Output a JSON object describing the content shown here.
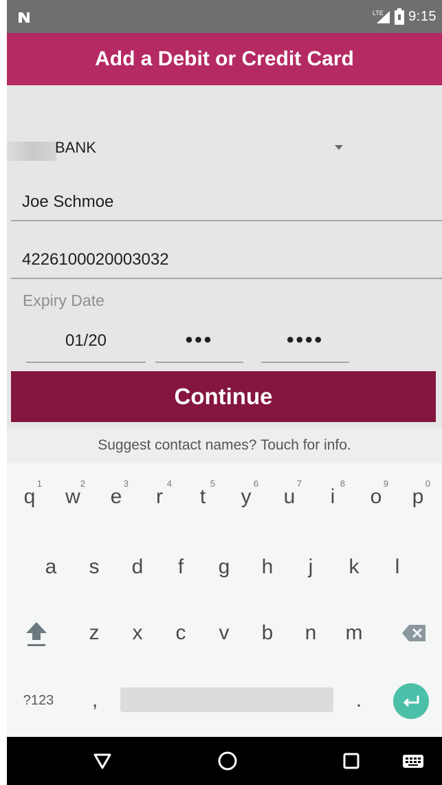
{
  "status_bar": {
    "time": "9:15",
    "network": "LTE"
  },
  "app_bar": {
    "title": "Add a Debit or Credit Card"
  },
  "form": {
    "bank": "BANK",
    "name": "Joe Schmoe",
    "card_number": "4226100020003032",
    "expiry_label": "Expiry Date",
    "expiry_value": "01/20",
    "cvv_masked": "•••",
    "pin_masked": "••••",
    "continue_label": "Continue"
  },
  "suggestion": {
    "text": "Suggest contact names? Touch for info."
  },
  "keyboard": {
    "row1": [
      "q",
      "w",
      "e",
      "r",
      "t",
      "y",
      "u",
      "i",
      "o",
      "p"
    ],
    "row1_hints": [
      "1",
      "2",
      "3",
      "4",
      "5",
      "6",
      "7",
      "8",
      "9",
      "0"
    ],
    "row2": [
      "a",
      "s",
      "d",
      "f",
      "g",
      "h",
      "j",
      "k",
      "l"
    ],
    "row3": [
      "z",
      "x",
      "c",
      "v",
      "b",
      "n",
      "m"
    ],
    "symbols_label": "?123",
    "comma": ",",
    "period": "."
  },
  "icons": {
    "status_left": "notification-n-icon",
    "signal": "signal-icon",
    "battery": "battery-icon",
    "dropdown": "dropdown-arrow-icon",
    "shift": "shift-icon",
    "backspace": "backspace-icon",
    "enter": "enter-icon",
    "back": "back-icon",
    "home": "home-icon",
    "recents": "recents-icon",
    "keyboard_switch": "keyboard-icon"
  },
  "colors": {
    "app_bar": "#b52a62",
    "continue_button": "#841640",
    "enter_key": "#4cbfa8",
    "status_bar": "#6f6f6f"
  }
}
